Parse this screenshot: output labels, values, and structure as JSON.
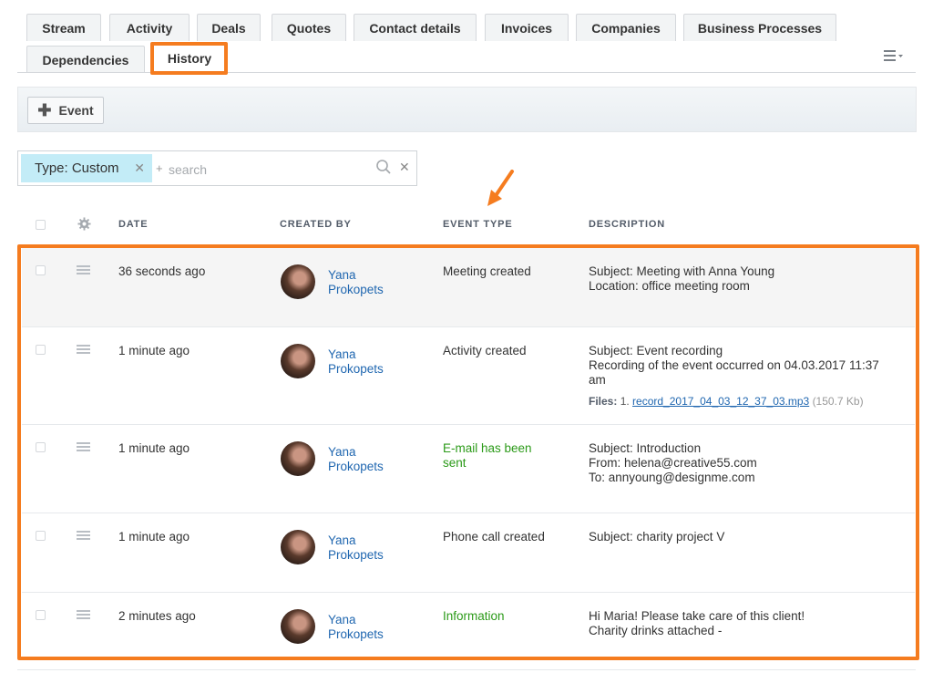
{
  "tabs": [
    {
      "label": "Stream"
    },
    {
      "label": "Activity"
    },
    {
      "label": "Deals"
    },
    {
      "label": "Quotes"
    },
    {
      "label": "Contact details"
    },
    {
      "label": "Invoices"
    },
    {
      "label": "Companies"
    },
    {
      "label": "Business Processes"
    },
    {
      "label": "Dependencies"
    },
    {
      "label": "History",
      "active": true
    }
  ],
  "toolbar": {
    "event_label": "Event"
  },
  "filter": {
    "chip_label": "Type: Custom",
    "plus": "+",
    "placeholder": "search"
  },
  "table": {
    "columns": {
      "date": "DATE",
      "created_by": "CREATED BY",
      "event_type": "EVENT TYPE",
      "description": "DESCRIPTION"
    },
    "rows": [
      {
        "date": "36 seconds ago",
        "author_first": "Yana",
        "author_last": "Prokopets",
        "event_type": "Meeting created",
        "event_type_color": "#333333",
        "desc1": "Subject: Meeting with Anna Young",
        "desc2": "Location: office meeting room",
        "desc3": ""
      },
      {
        "date": "1 minute ago",
        "author_first": "Yana",
        "author_last": "Prokopets",
        "event_type": "Activity created",
        "event_type_color": "#333333",
        "desc1": "Subject: Event recording",
        "desc2": "Recording of the event occurred on 04.03.2017 11:37",
        "desc3": "am",
        "files_label": "Files:",
        "file_index": "1.",
        "file_name": "record_2017_04_03_12_37_03.mp3",
        "file_size": "(150.7 Kb)"
      },
      {
        "date": "1 minute ago",
        "author_first": "Yana",
        "author_last": "Prokopets",
        "event_type": "E-mail has been sent",
        "event_type_color": "#2b9a18",
        "desc1": "Subject: Introduction",
        "desc2": "From: helena@creative55.com",
        "desc3": "To: annyoung@designme.com"
      },
      {
        "date": "1 minute ago",
        "author_first": "Yana",
        "author_last": "Prokopets",
        "event_type": "Phone call created",
        "event_type_color": "#333333",
        "desc1": "Subject: charity project V",
        "desc2": "",
        "desc3": ""
      },
      {
        "date": "2 minutes ago",
        "author_first": "Yana",
        "author_last": "Prokopets",
        "event_type": "Information",
        "event_type_color": "#2b9a18",
        "desc1": "Hi Maria! Please take care of this client!",
        "desc2": "Charity drinks attached  -",
        "desc3": ""
      }
    ]
  },
  "colors": {
    "highlight": "#f57c1f",
    "link": "#2067b0",
    "green": "#2b9a18"
  }
}
